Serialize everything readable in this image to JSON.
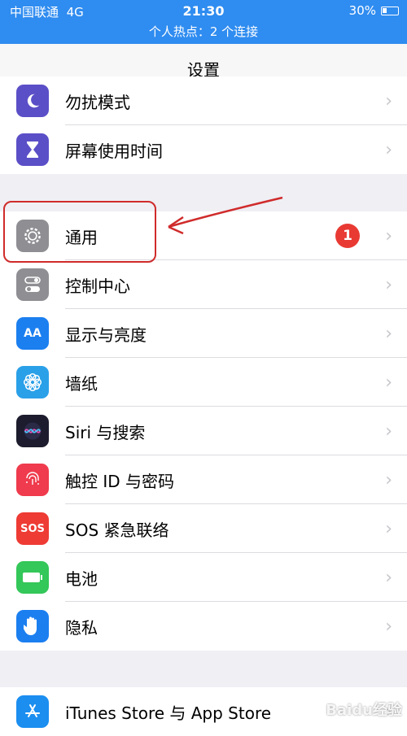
{
  "status_bar": {
    "carrier": "中国联通",
    "network": "4G",
    "time": "21:30",
    "battery": "30%",
    "hotspot": "个人热点：2 个连接"
  },
  "nav": {
    "title": "设置"
  },
  "group1": [
    {
      "label": "勿扰模式",
      "icon": "moon-icon",
      "color": "#5b4fc7"
    },
    {
      "label": "屏幕使用时间",
      "icon": "hourglass-icon",
      "color": "#5b4fc7"
    }
  ],
  "group2": [
    {
      "label": "通用",
      "icon": "gear-icon",
      "color": "#8e8e93",
      "badge": "1"
    },
    {
      "label": "控制中心",
      "icon": "toggles-icon",
      "color": "#8e8e93"
    },
    {
      "label": "显示与亮度",
      "icon": "text-size-icon",
      "color": "#1b7ff0"
    },
    {
      "label": "墙纸",
      "icon": "flower-icon",
      "color": "#2aa0e8"
    },
    {
      "label": "Siri 与搜索",
      "icon": "siri-icon",
      "color": "#1c1c2e"
    },
    {
      "label": "触控 ID 与密码",
      "icon": "fingerprint-icon",
      "color": "#ef3b4d"
    },
    {
      "label": "SOS 紧急联络",
      "icon": "sos-icon",
      "color": "#ee3b34",
      "icon_text": "SOS"
    },
    {
      "label": "电池",
      "icon": "battery-icon",
      "color": "#34c759"
    },
    {
      "label": "隐私",
      "icon": "hand-icon",
      "color": "#1b7ff0"
    }
  ],
  "group3": [
    {
      "label": "iTunes Store 与 App Store",
      "icon": "app-store-icon",
      "color": "#1b8ef0"
    }
  ],
  "watermark": "Baidu经验"
}
